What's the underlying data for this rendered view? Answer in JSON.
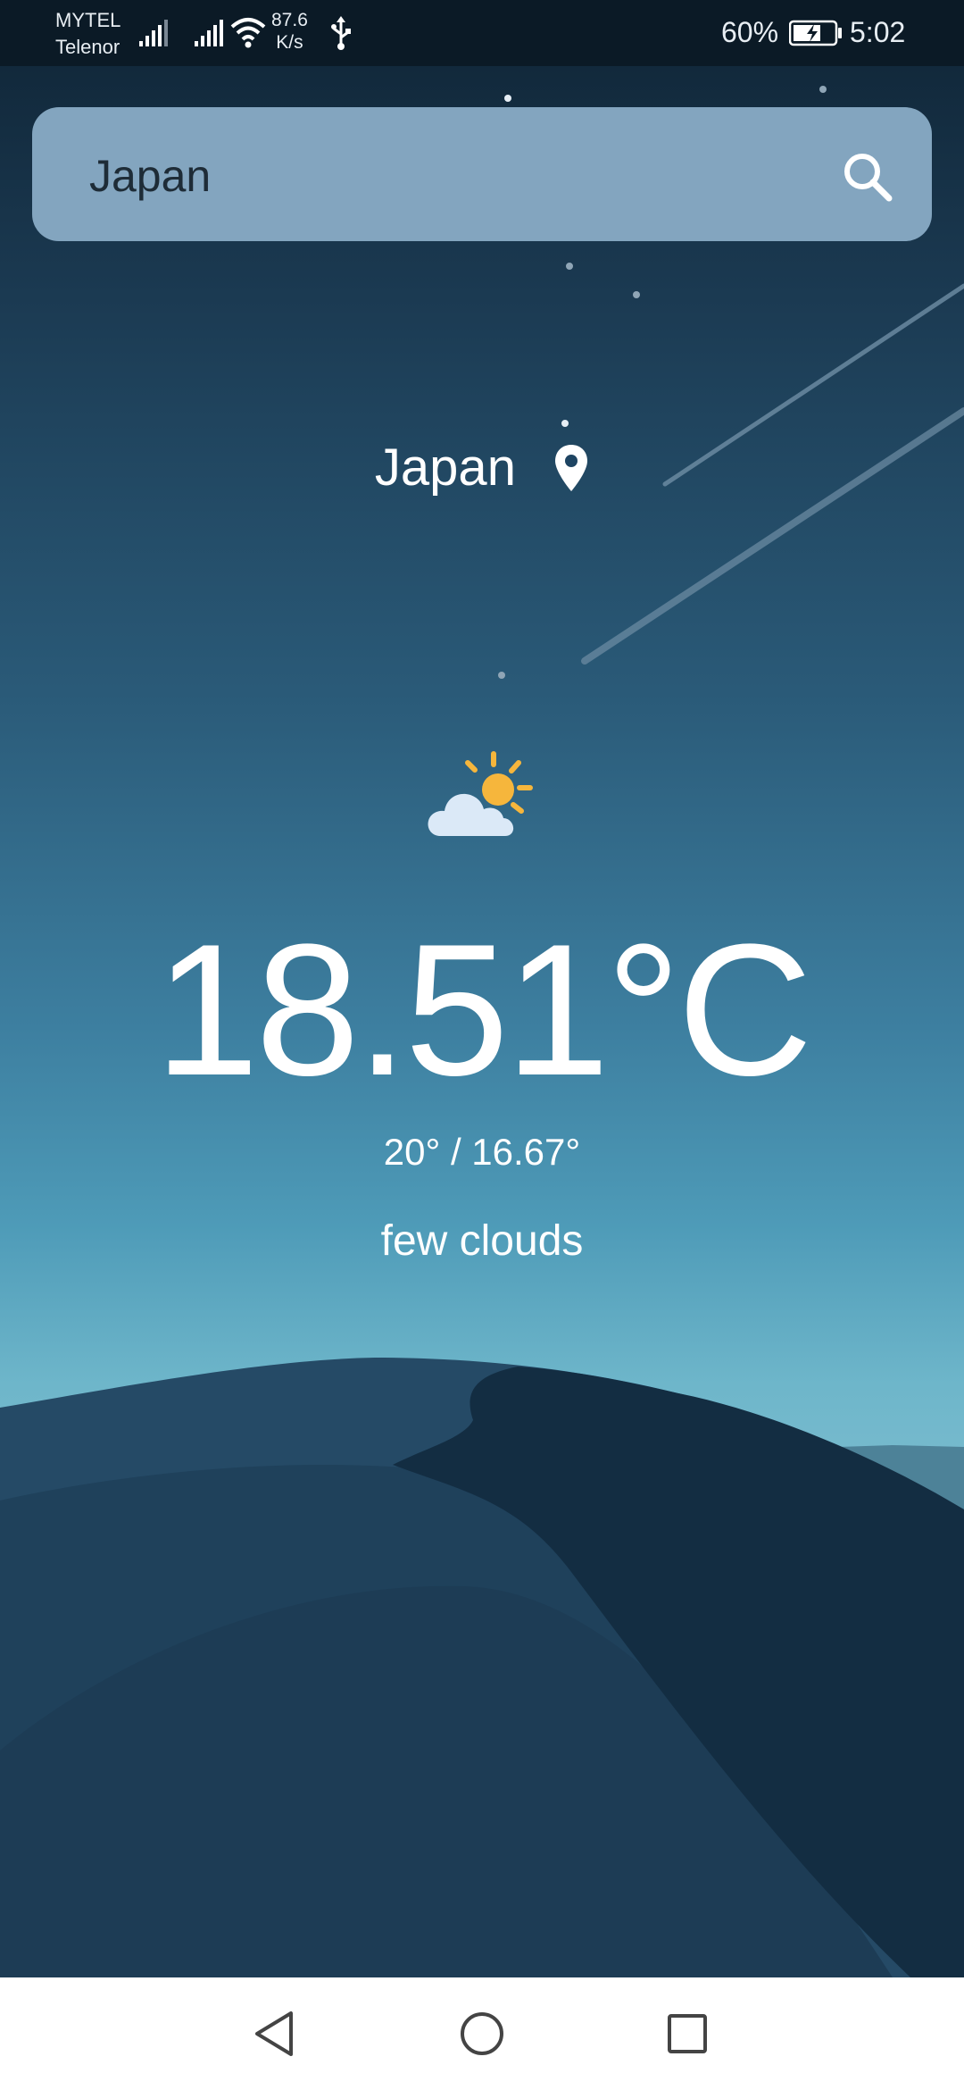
{
  "status_bar": {
    "carrier_1": "MYTEL",
    "carrier_2": "Telenor",
    "speed_value": "87.6",
    "speed_unit": "K/s",
    "battery_percent": "60%",
    "time": "5:02"
  },
  "search": {
    "value": "Japan",
    "icon": "search-icon"
  },
  "location": {
    "name": "Japan",
    "icon": "location-pin-icon"
  },
  "weather": {
    "icon": "partly-cloudy-icon",
    "temperature": "18.51°C",
    "min_max": "20° / 16.67°",
    "description": "few clouds"
  },
  "nav": {
    "back_icon": "back-triangle-icon",
    "home_icon": "home-circle-icon",
    "recent_icon": "recent-square-icon"
  },
  "colors": {
    "search_bg": "#83a5bf",
    "sun": "#f6b63c",
    "cloud": "#dbe9f7"
  }
}
